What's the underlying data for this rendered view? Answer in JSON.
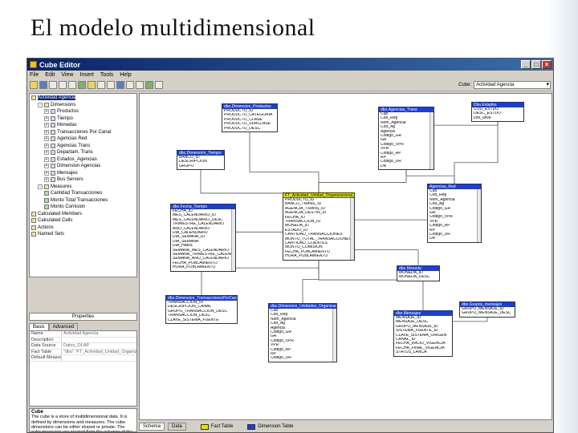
{
  "slide": {
    "title": "El modelo multidimensional"
  },
  "window": {
    "title": "Cube Editor",
    "controls": [
      "_",
      "□",
      "×"
    ],
    "menu": [
      "File",
      "Edit",
      "View",
      "Insert",
      "Tools",
      "Help"
    ],
    "cube_label": "Cube:",
    "cube_value": "Actividad Agencia"
  },
  "tree": [
    {
      "label": "Actividad Agencia",
      "kind": "cube",
      "indent": 0,
      "selected": true
    },
    {
      "label": "Dimensions",
      "kind": "folder",
      "indent": 1,
      "pm": "-"
    },
    {
      "label": "Productos",
      "kind": "dim",
      "indent": 2,
      "pm": "+"
    },
    {
      "label": "Tiempo",
      "kind": "dim",
      "indent": 2,
      "pm": "+"
    },
    {
      "label": "Monedas",
      "kind": "dim",
      "indent": 2,
      "pm": "+"
    },
    {
      "label": "Transacciones Por Canal",
      "kind": "dim",
      "indent": 2,
      "pm": "+"
    },
    {
      "label": "Agencias Red",
      "kind": "dim",
      "indent": 2,
      "pm": "+"
    },
    {
      "label": "Agencias Trans",
      "kind": "dim",
      "indent": 2,
      "pm": "+"
    },
    {
      "label": "Departam. Trans",
      "kind": "dim",
      "indent": 2,
      "pm": "+"
    },
    {
      "label": "Estados_Agencias",
      "kind": "dim",
      "indent": 2,
      "pm": "+"
    },
    {
      "label": "Dimension Agencias",
      "kind": "dim",
      "indent": 2,
      "pm": "+"
    },
    {
      "label": "Mensajes",
      "kind": "dim",
      "indent": 2,
      "pm": "+"
    },
    {
      "label": "Bus Servers",
      "kind": "dim",
      "indent": 2,
      "pm": "+"
    },
    {
      "label": "Measures",
      "kind": "folder",
      "indent": 1,
      "pm": "-"
    },
    {
      "label": "Cantidad Transacciones",
      "kind": "meas",
      "indent": 2
    },
    {
      "label": "Monto Total Transacciones",
      "kind": "meas",
      "indent": 2
    },
    {
      "label": "Monto Comision",
      "kind": "meas",
      "indent": 2
    },
    {
      "label": "Calculated Members",
      "kind": "folder",
      "indent": 0
    },
    {
      "label": "Calculated Cells",
      "kind": "folder",
      "indent": 0
    },
    {
      "label": "Actions",
      "kind": "folder",
      "indent": 0
    },
    {
      "label": "Named Sets",
      "kind": "folder",
      "indent": 0
    }
  ],
  "properties": {
    "selector": "Properties",
    "tabs": [
      "Basic",
      "Advanced"
    ],
    "rows": [
      {
        "k": "Name",
        "v": "Actividad Agencia"
      },
      {
        "k": "Description",
        "v": ""
      },
      {
        "k": "Data Source",
        "v": "Datos_OLAP"
      },
      {
        "k": "Fact Table",
        "v": "\"dbo\".\"FT_Actividad_Unidad_Organiza"
      },
      {
        "k": "Default Measure",
        "v": ""
      }
    ],
    "desc_title": "Cube",
    "desc_text": "The cube is a store of multidimensional data. It is defined by dimensions and measures. The cube dimensions can be either shared or private. The cube measures are created from the columns of the cube's"
  },
  "tables": [
    {
      "id": "t1",
      "title": "dbo.Dimension_Productos",
      "fact": false,
      "rows": [
        "PRODUCTO_ID",
        "PRODUCTO_CATEGORIA",
        "PRODUCTO_CLASE",
        "PRODUCTO_SUBCLASE",
        "PRODUCTO_DESC"
      ]
    },
    {
      "id": "t2",
      "title": "dbo.Agencias_Trans",
      "fact": false,
      "rows": [
        "Cub",
        "Cod_Reg",
        "Nom_Agencia",
        "Cod_Ag",
        "Agencia",
        "Codigo_GR",
        "GR",
        "Codigo_VPR",
        "VPR",
        "Codigo_RP",
        "RP",
        "Codigo_DR",
        "DR"
      ]
    },
    {
      "id": "t3",
      "title": "Dbo.Estados",
      "fact": false,
      "rows": [
        "COD_ESTDO",
        "DESC_ESTDO",
        "cod_unve"
      ]
    },
    {
      "id": "t4",
      "title": "dbo.Dimension_Tiempo",
      "fact": false,
      "rows": [
        "BANCO_ID",
        "DESCRIPCION",
        "GRUPO"
      ]
    },
    {
      "id": "t5",
      "title": "dbo.Fecha_Tiempo",
      "fact": false,
      "rows": [
        "FECHA_ID",
        "MES_CALENDARIO_ID",
        "MES_CALENDARIO_DESC",
        "TRIMESTRE_CALENDARIO",
        "ANO_CALENDARIO",
        "DIA_CALENDARIO",
        "DIA_SEMANA_ID",
        "DIA_SEMANA",
        "DIA_HABIL",
        "SEMANA_MES_CALENDARIO",
        "SEMANA_TRIMESTRE_CALEND",
        "SEMANA_ANO_CALENDARIO",
        "FECHA_POBLAMIENTO",
        "HORA_POBLAMIENTO"
      ]
    },
    {
      "id": "t6",
      "title": "FT_Actividad_Unidad_Organizacional_C",
      "fact": true,
      "rows": [
        "PRODUCTO_ID",
        "BANCO_TRANS_ID",
        "AGENCIA_TRANS_ID",
        "AGENCIA_DESTIN_ID",
        "FECHA_ID",
        "TRANSACCION_ID",
        "MONEDA_ID",
        "ESTADO_ID",
        "CANTIDAD_TRANSACCIONES",
        "MONTO_TOTAL_TRANSACCIONES",
        "CANTIDAD_CLIENTES",
        "MONTO_COMISION",
        "FECHA_POBLAMIENTO",
        "HORA_POBLAMIENTO"
      ]
    },
    {
      "id": "t7",
      "title": "Agencias_Red",
      "fact": false,
      "rows": [
        "Cub",
        "Cod_Reg",
        "Nom_Agencia",
        "Cod_Ag",
        "Codigo_GR",
        "GR",
        "Codigo_VPR",
        "VPR",
        "Codigo_RP",
        "RP",
        "Codigo_DR",
        "DR"
      ]
    },
    {
      "id": "t8",
      "title": "dbo.Moneda",
      "fact": false,
      "rows": [
        "MONEDA_ID",
        "MONEDA_DESC"
      ]
    },
    {
      "id": "t9",
      "title": "dbo.Dimension_TransaccionesPorCanal",
      "fact": false,
      "rows": [
        "TRANSACCION_ID",
        "DESCRIPCION_CANAL",
        "GRUPO_TRANSACCION_DESC",
        "TRANSACCION_DESC",
        "CLAVE_SISTEMA_FUENTE"
      ]
    },
    {
      "id": "t10",
      "title": "dbo.Dimension_Unidades_Organizacionales",
      "fact": false,
      "rows": [
        "Cub",
        "Cod_Reg",
        "Nom_Agencia",
        "Cod_Ag",
        "Agencia",
        "Codigo_GR",
        "GR",
        "Codigo_VPR",
        "VPR",
        "Codigo_RP",
        "RP",
        "Codigo_DR"
      ]
    },
    {
      "id": "t11",
      "title": "dbo.Mensajes",
      "fact": false,
      "rows": [
        "MENSAJE_ID",
        "MENSAJE_DESC",
        "GRUPO_MENSAJE_ID",
        "SISTEMA_FUENTE_ID",
        "CLAVE_SISTEMA_ORIGEN",
        "CANAL_ID",
        "FECHA_INICIO_VIGENCIA",
        "FECHA_FINAL_VIGENCIA",
        "STATUS_LANCA"
      ]
    },
    {
      "id": "t12",
      "title": "dbo.Grupos_mensajes",
      "fact": false,
      "rows": [
        "GRUPO_MENSAJE_ID",
        "GRUPO_MENSAJE_DESC"
      ]
    }
  ],
  "bottom": {
    "tabs": [
      "Schema",
      "Data"
    ],
    "legend": [
      {
        "label": "Fact Table",
        "color": "#e8e200"
      },
      {
        "label": "Dimension Table",
        "color": "#1c3fd1"
      }
    ]
  }
}
